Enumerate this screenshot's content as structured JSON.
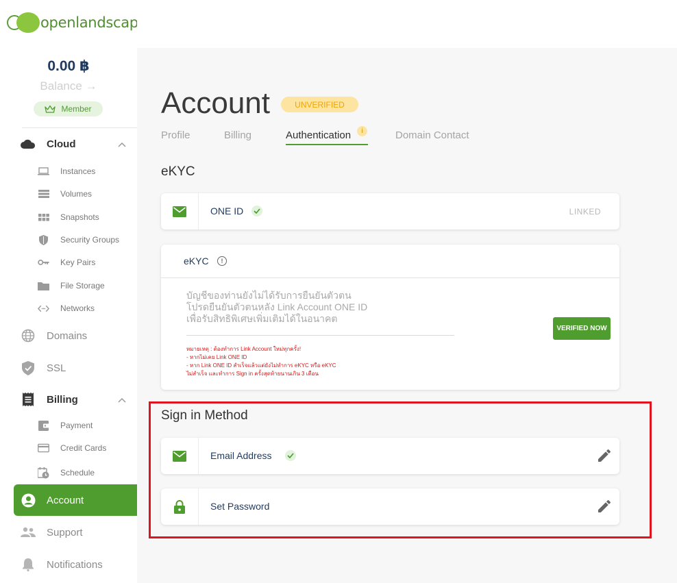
{
  "brand": {
    "logo_text": "openlandscape"
  },
  "balance": {
    "amount": "0.00 ฿",
    "label": "Balance →",
    "badge": "Member"
  },
  "sidebar": {
    "cloud": {
      "label": "Cloud",
      "items": [
        "Instances",
        "Volumes",
        "Snapshots",
        "Security Groups",
        "Key Pairs",
        "File Storage",
        "Networks"
      ]
    },
    "domains": "Domains",
    "ssl": "SSL",
    "billing": {
      "label": "Billing",
      "items": [
        "Payment",
        "Credit Cards",
        "Schedule"
      ]
    },
    "account": "Account",
    "support": "Support",
    "notifications": "Notifications"
  },
  "page": {
    "title": "Account",
    "status": "UNVERIFIED",
    "tabs": [
      "Profile",
      "Billing",
      "Authentication",
      "Domain Contact"
    ],
    "tab_info": "i"
  },
  "ekyc_section": {
    "title": "eKYC",
    "one_id": {
      "label": "ONE ID",
      "status": "LINKED"
    },
    "card": {
      "title": "eKYC",
      "info": "!",
      "message": [
        "บัญชีของท่านยังไม่ได้รับการยืนยันตัวตน",
        "โปรดยืนยันตัวตนหลัง Link Account ONE ID",
        "เพื่อรับสิทธิพิเศษเพิ่มเติมได้ในอนาคต"
      ],
      "notes": [
        "หมายเหตุ : ต้องทำการ Link Account ใหม่ทุกครั้ง!",
        "- หากไม่เคย Link ONE ID",
        "- หาก Link ONE ID สำเร็จแล้วแต่ยังไม่ทำการ eKYC หรือ eKYC",
        "ไม่สำเร็จ และทำการ Sign in ครั้งสุดท้ายนานเกิน 3 เดือน"
      ],
      "button": "VERIFIED NOW"
    }
  },
  "signin_section": {
    "title": "Sign in Method",
    "email": {
      "label": "Email Address"
    },
    "password": {
      "label": "Set Password"
    }
  },
  "colors": {
    "brand_green": "#4f9c2f",
    "highlight": "#e0141f",
    "warning": "#fde4a0",
    "navy": "#1e3a5f"
  }
}
